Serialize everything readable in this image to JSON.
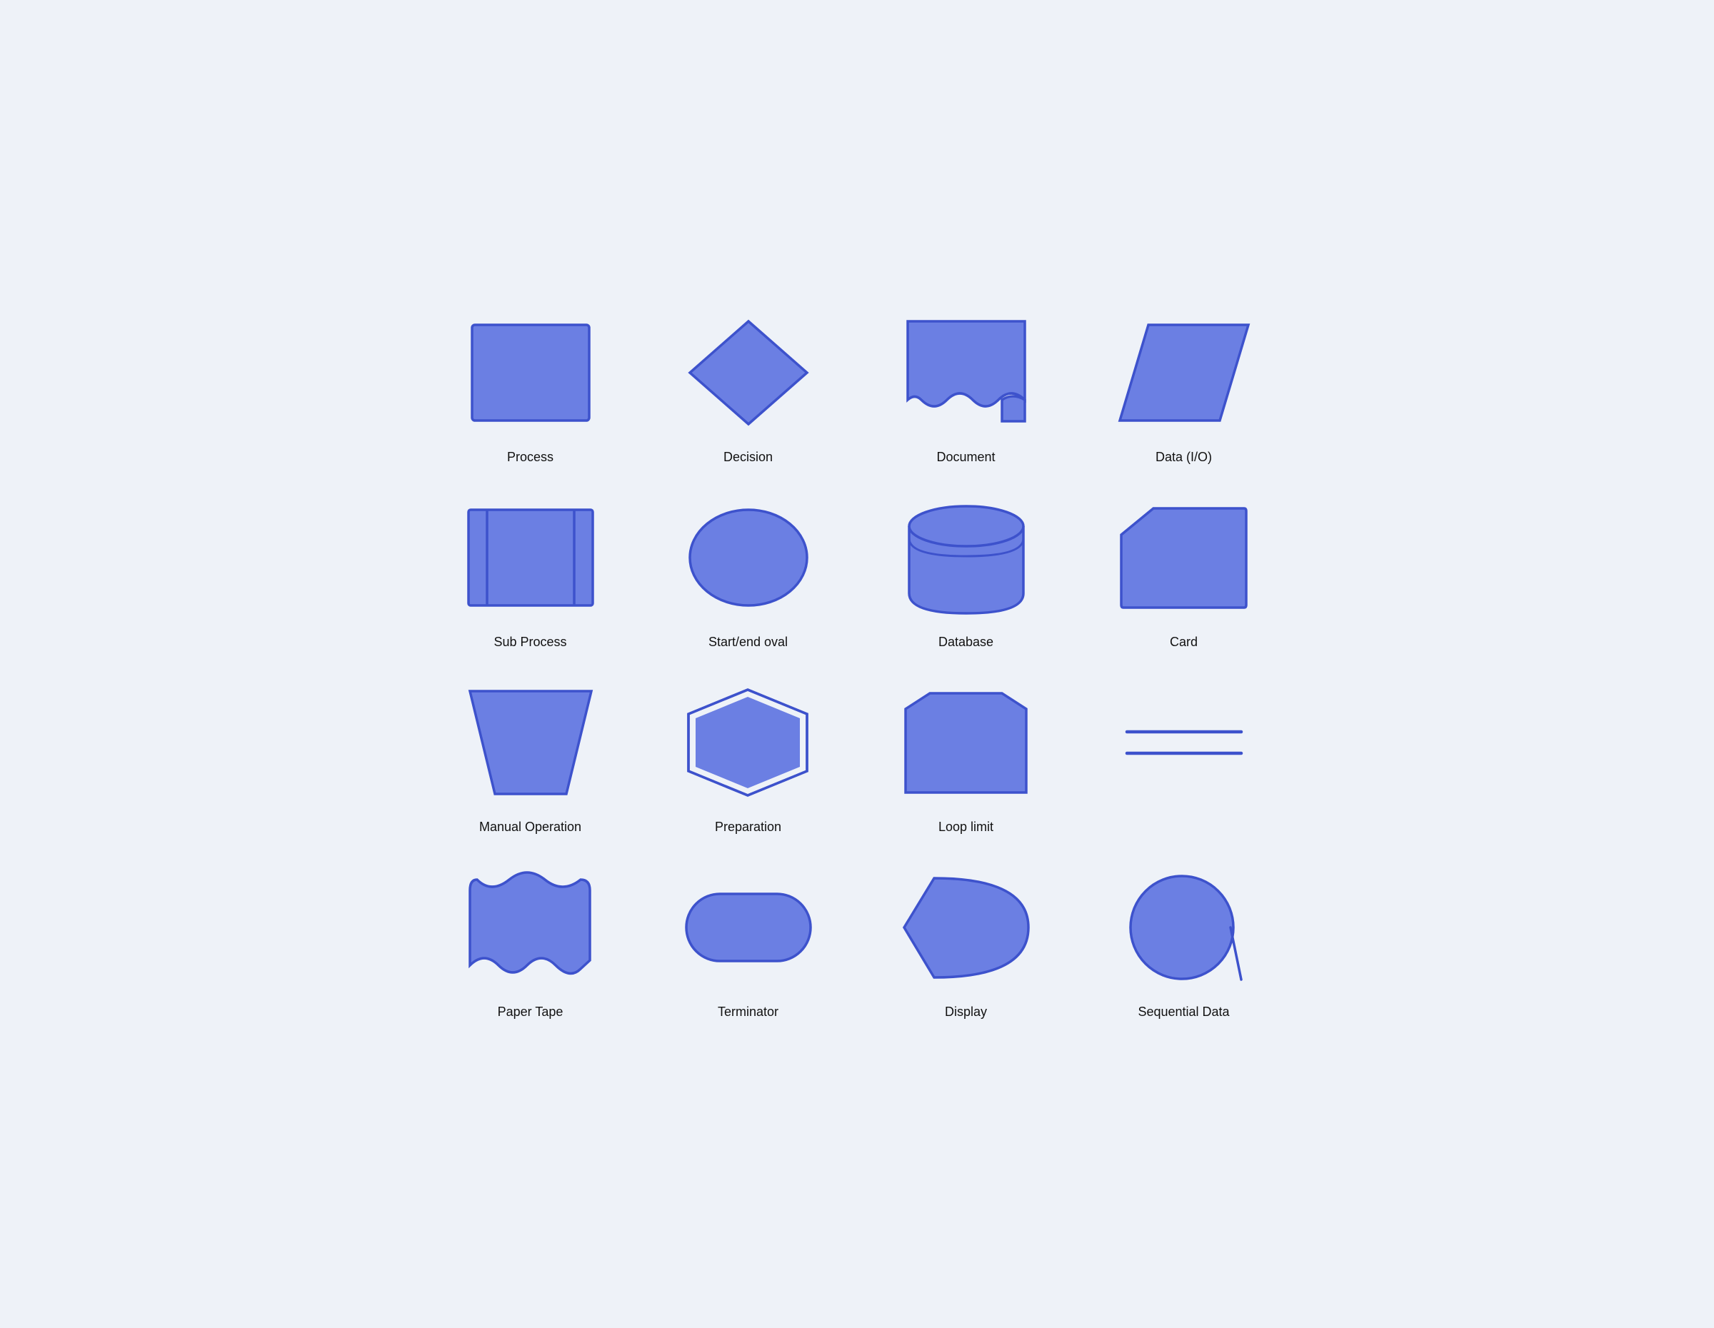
{
  "shapes": [
    {
      "id": "process",
      "label": "Process"
    },
    {
      "id": "decision",
      "label": "Decision"
    },
    {
      "id": "document",
      "label": "Document"
    },
    {
      "id": "data-io",
      "label": "Data (I/O)"
    },
    {
      "id": "sub-process",
      "label": "Sub Process"
    },
    {
      "id": "start-end-oval",
      "label": "Start/end oval"
    },
    {
      "id": "database",
      "label": "Database"
    },
    {
      "id": "card",
      "label": "Card"
    },
    {
      "id": "manual-operation",
      "label": "Manual Operation"
    },
    {
      "id": "preparation",
      "label": "Preparation"
    },
    {
      "id": "loop-limit",
      "label": "Loop limit"
    },
    {
      "id": "connector",
      "label": ""
    },
    {
      "id": "paper-tape",
      "label": "Paper Tape"
    },
    {
      "id": "terminator",
      "label": "Terminator"
    },
    {
      "id": "display",
      "label": "Display"
    },
    {
      "id": "sequential-data",
      "label": "Sequential Data"
    }
  ],
  "colors": {
    "fill": "#6B7FE3",
    "stroke": "#3D52CC",
    "bg": "#eef2f8"
  }
}
